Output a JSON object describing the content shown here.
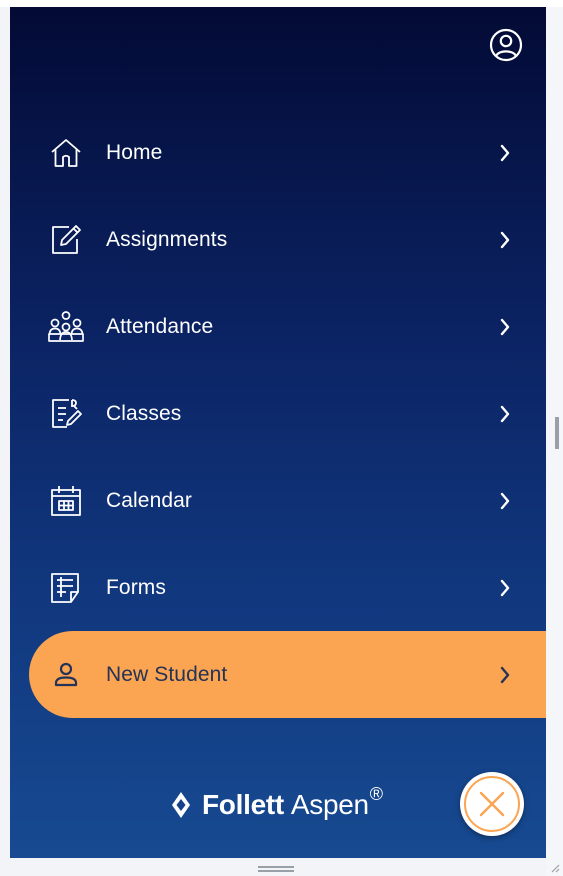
{
  "colors": {
    "panel_top": "#030a35",
    "panel_bottom": "#174a91",
    "accent": "#fba451",
    "active_text": "#243356",
    "text": "#ffffff"
  },
  "header": {
    "profile_icon": "user-circle-icon"
  },
  "nav": {
    "items": [
      {
        "label": "Home",
        "icon": "home-icon",
        "active": false
      },
      {
        "label": "Assignments",
        "icon": "assignment-edit-icon",
        "active": false
      },
      {
        "label": "Attendance",
        "icon": "attendance-people-icon",
        "active": false
      },
      {
        "label": "Classes",
        "icon": "classes-grade-icon",
        "active": false
      },
      {
        "label": "Calendar",
        "icon": "calendar-icon",
        "active": false
      },
      {
        "label": "Forms",
        "icon": "forms-icon",
        "active": false
      },
      {
        "label": "New Student",
        "icon": "person-icon",
        "active": true
      }
    ]
  },
  "footer": {
    "brand_bold": "Follett",
    "brand_light": "Aspen",
    "registered": "®",
    "close_icon": "close-icon"
  }
}
